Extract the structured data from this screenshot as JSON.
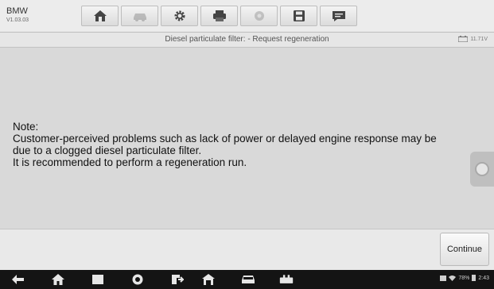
{
  "header": {
    "make": "BMW",
    "version": "V1.03.03",
    "toolbar": [
      {
        "icon": "home-icon",
        "enabled": true
      },
      {
        "icon": "vehicle-swap-icon",
        "enabled": false
      },
      {
        "icon": "settings-gear-icon",
        "enabled": true
      },
      {
        "icon": "print-icon",
        "enabled": true
      },
      {
        "icon": "help-icon",
        "enabled": false
      },
      {
        "icon": "save-icon",
        "enabled": true
      },
      {
        "icon": "message-icon",
        "enabled": true
      }
    ]
  },
  "titlebar": {
    "title": "Diesel particulate filter: - Request regeneration",
    "battery_voltage": "11.71V"
  },
  "message": {
    "heading": "Note:",
    "line1": "Customer-perceived problems such as lack of power or delayed engine response may be",
    "line2": "due to a clogged diesel particulate filter.",
    "line3": "It is recommended to perform a regeneration run."
  },
  "footer": {
    "continue_label": "Continue"
  },
  "system_bar": {
    "icons": [
      "back-icon",
      "home-icon",
      "recent-apps-icon",
      "browser-icon",
      "remote-desk-icon",
      "diagnostics-home-icon",
      "vehicle-icon",
      "vci-icon"
    ],
    "battery_percent": "78%",
    "time": "2:43"
  },
  "colors": {
    "background": "#d9d9d9",
    "header": "#ececec",
    "navbar": "#141414",
    "icon": "#444444"
  }
}
